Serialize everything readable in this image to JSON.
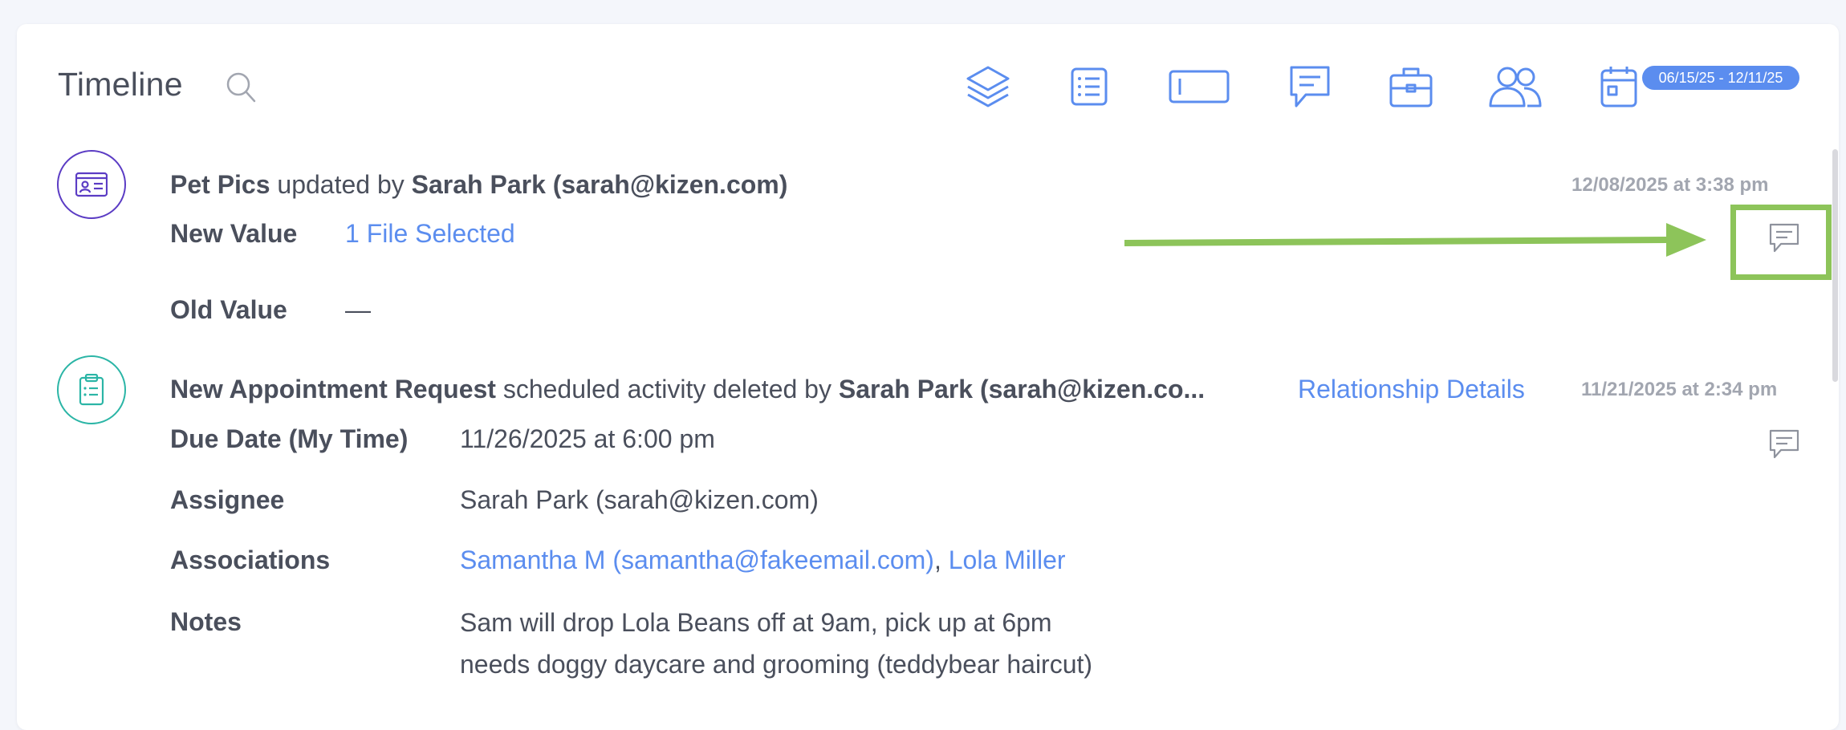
{
  "header": {
    "title": "Timeline",
    "date_range": "06/15/25 - 12/11/25"
  },
  "toolbar": {
    "icons": [
      "layers-icon",
      "list-icon",
      "field-icon",
      "comment-icon",
      "briefcase-icon",
      "users-icon",
      "calendar-icon"
    ]
  },
  "entries": [
    {
      "avatar_icon": "id-card-icon",
      "avatar_color": "#5b3cc4",
      "subject": "Pet Pics",
      "action": " updated by ",
      "actor": "Sarah Park (sarah@kizen.com)",
      "timestamp": "12/08/2025 at 3:38 pm",
      "new_value_label": "New Value",
      "new_value": "1 File Selected",
      "old_value_label": "Old Value",
      "old_value": "—"
    },
    {
      "avatar_icon": "clipboard-icon",
      "avatar_color": "#2bb5a6",
      "subject": "New Appointment Request",
      "action": " scheduled activity deleted by ",
      "actor": "Sarah Park (sarah@kizen.co...",
      "relationship_link": "Relationship Details",
      "timestamp": "11/21/2025 at 2:34 pm",
      "due_label": "Due Date (My Time)",
      "due_value": "11/26/2025 at 6:00 pm",
      "assignee_label": "Assignee",
      "assignee_value": "Sarah Park (sarah@kizen.com)",
      "associations_label": "Associations",
      "association_1": "Samantha M (samantha@fakeemail.com)",
      "association_sep": ", ",
      "association_2": "Lola Miller",
      "notes_label": "Notes",
      "notes_line_1": "Sam will drop Lola Beans off at 9am, pick up at 6pm",
      "notes_line_2": "needs doggy daycare and grooming (teddybear haircut)"
    }
  ],
  "colors": {
    "accent": "#5b8def",
    "annotation": "#8dc45a"
  }
}
